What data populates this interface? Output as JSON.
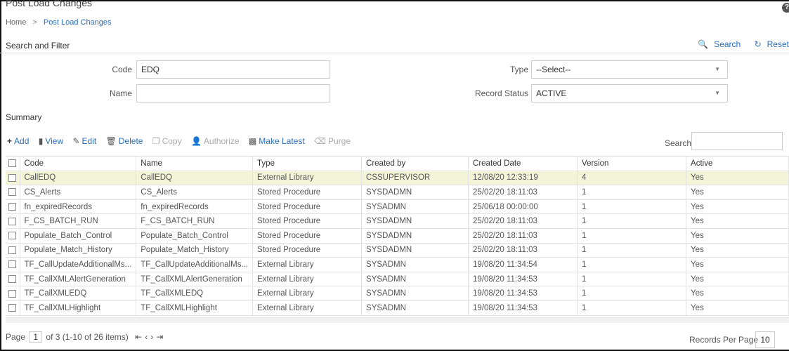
{
  "page": {
    "title": "Post Load Changes"
  },
  "breadcrumb": {
    "home": "Home",
    "sep": ">",
    "current": "Post Load Changes"
  },
  "search_filter": {
    "heading": "Search and Filter",
    "search_label": "Search",
    "reset_label": "Reset",
    "code_label": "Code",
    "code_value": "EDQ",
    "name_label": "Name",
    "name_value": "",
    "type_label": "Type",
    "type_value": "--Select--",
    "status_label": "Record Status",
    "status_value": "ACTIVE"
  },
  "summary": {
    "heading": "Summary"
  },
  "toolbar": {
    "add": "Add",
    "view": "View",
    "edit": "Edit",
    "delete": "Delete",
    "copy": "Copy",
    "authorize": "Authorize",
    "make_latest": "Make Latest",
    "purge": "Purge",
    "search_label": "Search"
  },
  "table": {
    "columns": [
      "Code",
      "Name",
      "Type",
      "Created by",
      "Created Date",
      "Version",
      "Active"
    ],
    "rows": [
      [
        "CallEDQ",
        "CallEDQ",
        "External Library",
        "CSSUPERVISOR",
        "12/08/20 12:33:19",
        "4",
        "Yes"
      ],
      [
        "CS_Alerts",
        "CS_Alerts",
        "Stored Procedure",
        "SYSDADMN",
        "25/02/20 18:11:03",
        "1",
        "Yes"
      ],
      [
        "fn_expiredRecords",
        "fn_expiredRecords",
        "Stored Procedure",
        "SYSADMN",
        "25/06/18 00:00:00",
        "1",
        "Yes"
      ],
      [
        "F_CS_BATCH_RUN",
        "F_CS_BATCH_RUN",
        "Stored Procedure",
        "SYSDADMN",
        "25/02/20 18:11:03",
        "1",
        "Yes"
      ],
      [
        "Populate_Batch_Control",
        "Populate_Batch_Control",
        "Stored Procedure",
        "SYSDADMN",
        "25/02/20 18:11:03",
        "1",
        "Yes"
      ],
      [
        "Populate_Match_History",
        "Populate_Match_History",
        "Stored Procedure",
        "SYSDADMN",
        "25/02/20 18:11:03",
        "1",
        "Yes"
      ],
      [
        "TF_CallUpdateAdditionalMs...",
        "TF_CallUpdateAdditionalMs...",
        "External Library",
        "SYSADMN",
        "19/08/20 11:34:54",
        "1",
        "Yes"
      ],
      [
        "TF_CallXMLAlertGeneration",
        "TF_CallXMLAlertGeneration",
        "External Library",
        "SYSADMN",
        "19/08/20 11:34:53",
        "1",
        "Yes"
      ],
      [
        "TF_CallXMLEDQ",
        "TF_CallXMLEDQ",
        "External Library",
        "SYSADMN",
        "19/08/20 11:34:53",
        "1",
        "Yes"
      ],
      [
        "TF_CallXMLHighlight",
        "TF_CallXMLHighlight",
        "External Library",
        "SYSADMN",
        "19/08/20 11:34:53",
        "1",
        "Yes"
      ]
    ]
  },
  "pager": {
    "page_label": "Page",
    "page_value": "1",
    "info": "of 3 (1-10 of 26 items)",
    "rpp_label": "Records Per Page",
    "rpp_value": "10"
  }
}
